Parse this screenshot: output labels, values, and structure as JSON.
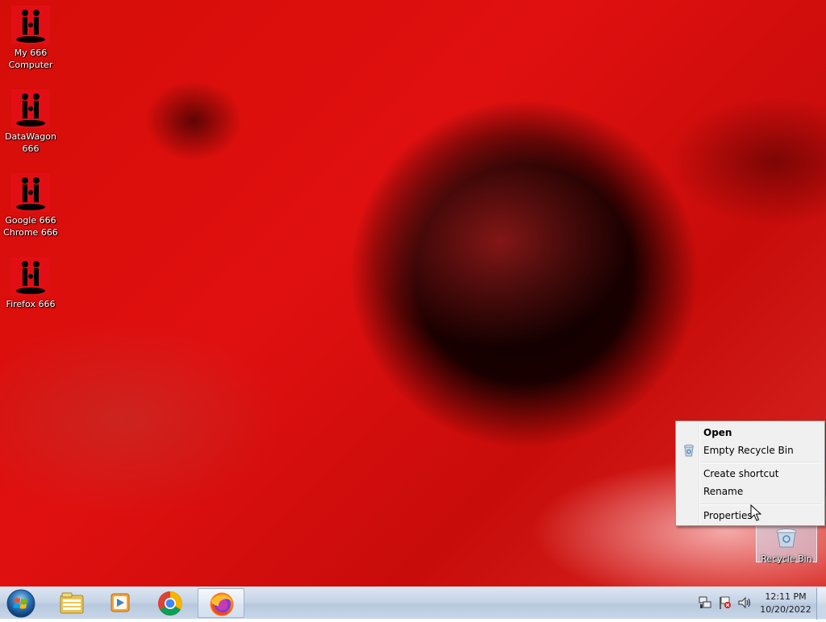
{
  "desktop": {
    "icons": [
      {
        "label_line1": "My 666",
        "label_line2": "Computer"
      },
      {
        "label_line1": "DataWagon",
        "label_line2": "666"
      },
      {
        "label_line1": "Google 666",
        "label_line2": "Chrome 666"
      },
      {
        "label_line1": "Firefox 666",
        "label_line2": ""
      }
    ],
    "recycle_bin": {
      "label": "Recycle Bin"
    }
  },
  "context_menu": {
    "items": [
      {
        "label": "Open"
      },
      {
        "label": "Empty Recycle Bin"
      },
      {
        "label": "Create shortcut"
      },
      {
        "label": "Rename"
      },
      {
        "label": "Properties"
      }
    ]
  },
  "taskbar": {
    "pinned": [
      "start-orb",
      "windows-explorer",
      "windows-media-player",
      "google-chrome",
      "firefox"
    ],
    "active_app": "firefox",
    "tray_icons": [
      "network-icon",
      "action-center-flag-icon",
      "volume-icon"
    ],
    "clock": {
      "time": "12:11 PM",
      "date": "10/20/2022"
    }
  },
  "colors": {
    "icon_background": "#e10f14",
    "taskbar": "#c6d4e6",
    "menu_background": "#f0f0f0"
  }
}
